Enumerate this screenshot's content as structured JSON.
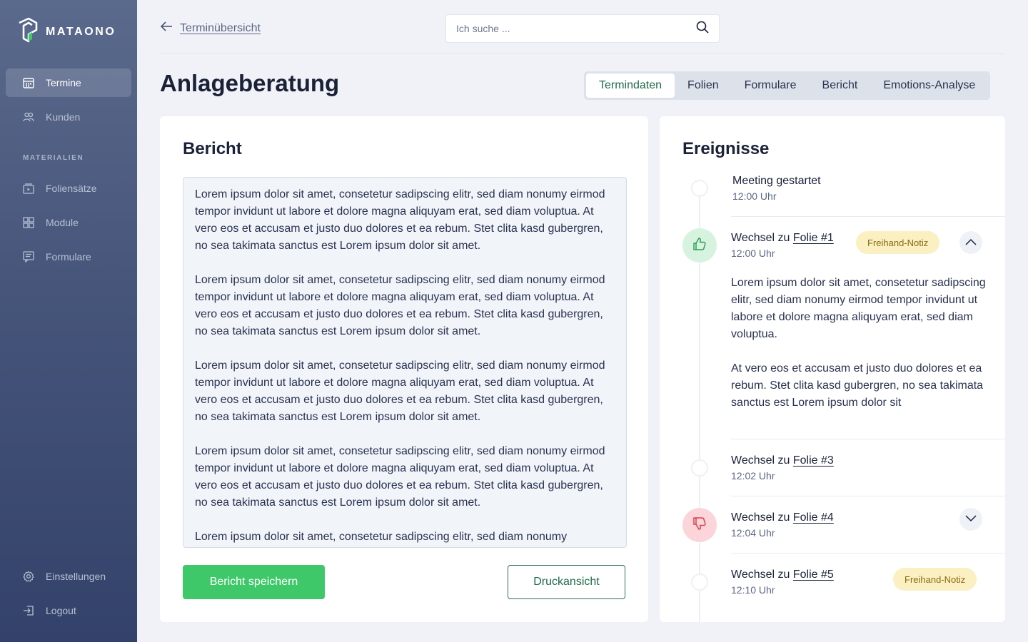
{
  "brand": {
    "name": "MATAONO"
  },
  "sidebar": {
    "items": [
      {
        "label": "Termine",
        "icon": "calendar-icon",
        "active": true
      },
      {
        "label": "Kunden",
        "icon": "users-icon",
        "active": false
      }
    ],
    "section_label": "MATERIALIEN",
    "materials": [
      {
        "label": "Foliensätze",
        "icon": "slides-icon"
      },
      {
        "label": "Module",
        "icon": "modules-icon"
      },
      {
        "label": "Formulare",
        "icon": "form-icon"
      }
    ],
    "bottom": [
      {
        "label": "Einstellungen",
        "icon": "gear-icon"
      },
      {
        "label": "Logout",
        "icon": "logout-icon"
      }
    ]
  },
  "header": {
    "back_label": "Terminübersicht",
    "search_placeholder": "Ich suche ..."
  },
  "page": {
    "title": "Anlageberatung",
    "tabs": [
      {
        "label": "Termindaten",
        "active": true
      },
      {
        "label": "Folien",
        "active": false
      },
      {
        "label": "Formulare",
        "active": false
      },
      {
        "label": "Bericht",
        "active": false
      },
      {
        "label": "Emotions-Analyse",
        "active": false
      }
    ]
  },
  "report": {
    "title": "Bericht",
    "paragraphs": [
      "Lorem ipsum dolor sit amet, consetetur sadipscing elitr, sed diam nonumy eirmod tempor invidunt ut labore et dolore magna aliquyam erat, sed diam voluptua. At vero eos et accusam et justo duo dolores et ea rebum. Stet clita kasd gubergren, no sea takimata sanctus est Lorem ipsum dolor sit amet.",
      "Lorem ipsum dolor sit amet, consetetur sadipscing elitr, sed diam nonumy eirmod tempor invidunt ut labore et dolore magna aliquyam erat, sed diam voluptua. At vero eos et accusam et justo duo dolores et ea rebum. Stet clita kasd gubergren, no sea takimata sanctus est Lorem ipsum dolor sit amet.",
      "Lorem ipsum dolor sit amet, consetetur sadipscing elitr, sed diam nonumy eirmod tempor invidunt ut labore et dolore magna aliquyam erat, sed diam voluptua. At vero eos et accusam et justo duo dolores et ea rebum. Stet clita kasd gubergren, no sea takimata sanctus est Lorem ipsum dolor sit amet.",
      "Lorem ipsum dolor sit amet, consetetur sadipscing elitr, sed diam nonumy eirmod tempor invidunt ut labore et dolore magna aliquyam erat, sed diam voluptua. At vero eos et accusam et justo duo dolores et ea rebum. Stet clita kasd gubergren, no sea takimata sanctus est Lorem ipsum dolor sit amet.",
      "Lorem ipsum dolor sit amet, consetetur sadipscing elitr, sed diam nonumy"
    ],
    "save_label": "Bericht speichern",
    "print_label": "Druckansicht"
  },
  "events": {
    "title": "Ereignisse",
    "items": [
      {
        "title": "Meeting gestartet",
        "time": "12:00 Uhr"
      },
      {
        "prefix": "Wechsel zu",
        "link": "Folie #1",
        "time": "12:00 Uhr",
        "badge": "Freihand-Notiz",
        "reaction": "thumbs-up-icon",
        "body": [
          "Lorem ipsum dolor sit amet, consetetur sadipscing elitr, sed diam nonumy eirmod tempor invidunt ut labore et dolore magna aliquyam erat, sed diam voluptua.",
          "At vero eos et accusam et justo duo dolores et ea rebum. Stet clita kasd gubergren, no sea takimata sanctus est Lorem ipsum dolor sit"
        ]
      },
      {
        "prefix": "Wechsel zu",
        "link": "Folie #3",
        "time": "12:02 Uhr"
      },
      {
        "prefix": "Wechsel zu",
        "link": "Folie #4",
        "time": "12:04 Uhr",
        "reaction": "thumbs-down-icon"
      },
      {
        "prefix": "Wechsel zu",
        "link": "Folie #5",
        "time": "12:10 Uhr",
        "badge": "Freihand-Notiz"
      }
    ]
  },
  "colors": {
    "accent_green": "#3ec86a",
    "badge_yellow": "#fbf0c2",
    "sidebar_top": "#5a6a8c",
    "sidebar_bottom": "#33426a"
  }
}
